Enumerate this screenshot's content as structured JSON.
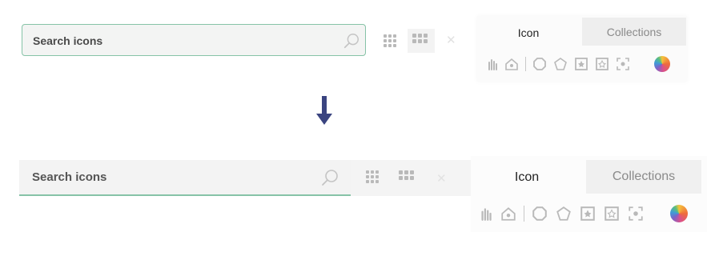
{
  "before": {
    "search": {
      "placeholder": "Search icons"
    },
    "tabs": [
      {
        "label": "Icon",
        "active": true
      },
      {
        "label": "Collections",
        "active": false
      }
    ],
    "icon_filters": [
      "hand-icon",
      "house-star-icon",
      "octagon-icon",
      "pentagon-icon",
      "square-star-icon",
      "square-outline-star-icon",
      "crosshair-icon",
      "color-wheel-icon"
    ]
  },
  "after": {
    "search": {
      "placeholder": "Search icons"
    },
    "tabs": [
      {
        "label": "Icon",
        "active": true
      },
      {
        "label": "Collections",
        "active": false
      }
    ],
    "icon_filters": [
      "hand-icon",
      "house-star-icon",
      "octagon-icon",
      "pentagon-icon",
      "square-star-icon",
      "square-outline-star-icon",
      "crosshair-icon",
      "color-wheel-icon"
    ]
  },
  "transition_arrow": "arrow-down-icon",
  "colors": {
    "accent_green": "#86c3a7",
    "arrow_navy": "#3a4480",
    "inactive_tab_bg": "#eeeeee",
    "icon_gray": "#b9b9b9"
  }
}
